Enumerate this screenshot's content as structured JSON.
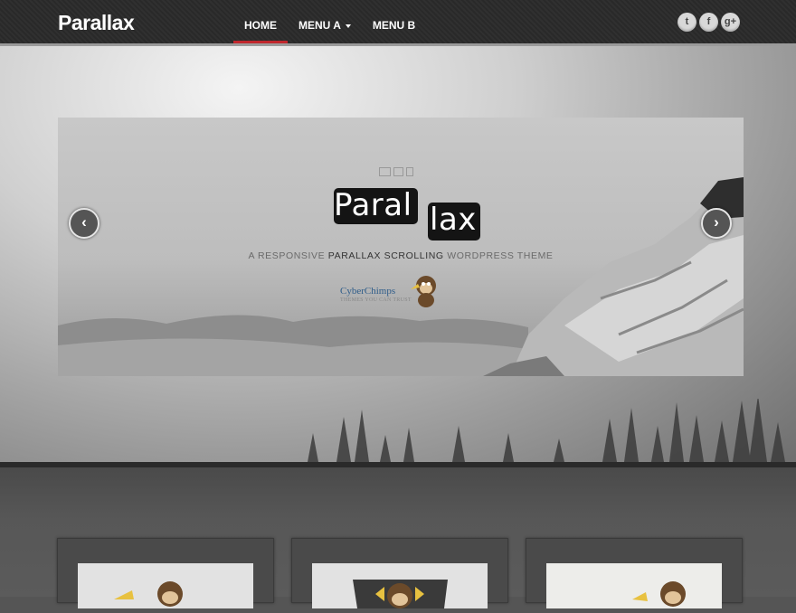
{
  "header": {
    "logo": "Parallax",
    "nav": [
      {
        "label": "HOME",
        "active": true,
        "has_caret": false
      },
      {
        "label": "MENU A",
        "active": false,
        "has_caret": true
      },
      {
        "label": "MENU B",
        "active": false,
        "has_caret": false
      }
    ],
    "social": [
      {
        "icon": "twitter-icon",
        "glyph": "t"
      },
      {
        "icon": "facebook-icon",
        "glyph": "f"
      },
      {
        "icon": "google-plus-icon",
        "glyph": "g+"
      }
    ]
  },
  "slider": {
    "title_part1": "Paral",
    "title_part2": "lax",
    "subtitle_prefix": "A RESPONSIVE ",
    "subtitle_bold": "PARALLAX SCROLLING",
    "subtitle_suffix": " WORDPRESS THEME",
    "brand_name": "CyberChimps",
    "brand_tagline": "THEMES YOU CAN TRUST",
    "prev_glyph": "‹",
    "next_glyph": "›"
  },
  "colors": {
    "accent": "#c0272d",
    "nav_bg": "#2b2b2b",
    "brand_blue": "#2f5d8a"
  }
}
